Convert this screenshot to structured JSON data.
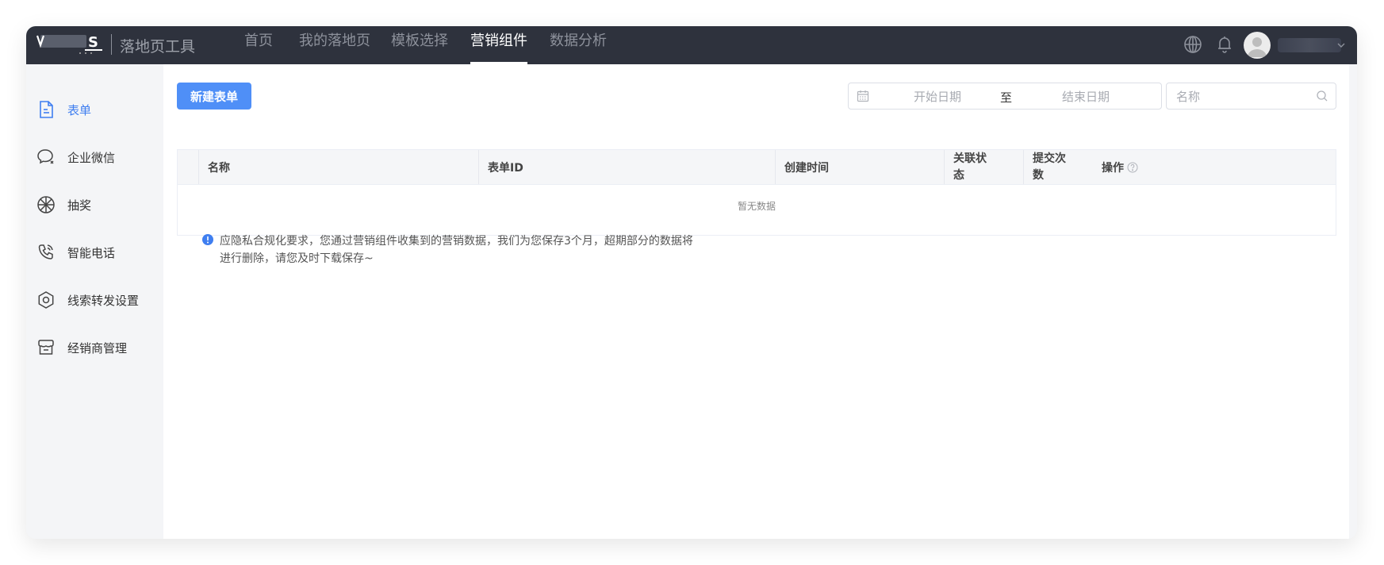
{
  "header": {
    "logo_text": "S",
    "app_title": "落地页工具",
    "tabs": [
      {
        "label": "首页"
      },
      {
        "label": "我的落地页"
      },
      {
        "label": "模板选择"
      },
      {
        "label": "营销组件",
        "active": true
      },
      {
        "label": "数据分析"
      }
    ],
    "icons": [
      "globe-icon",
      "bell-icon",
      "avatar",
      "chevron-down-icon"
    ]
  },
  "sidebar": {
    "items": [
      {
        "label": "表单",
        "icon": "form-icon",
        "active": true
      },
      {
        "label": "企业微信",
        "icon": "wechat-work-icon"
      },
      {
        "label": "抽奖",
        "icon": "lottery-wheel-icon"
      },
      {
        "label": "智能电话",
        "icon": "phone-icon"
      },
      {
        "label": "线索转发设置",
        "icon": "hexagon-settings-icon"
      },
      {
        "label": "经销商管理",
        "icon": "store-icon"
      }
    ]
  },
  "toolbar": {
    "new_form_label": "新建表单",
    "date_start_placeholder": "开始日期",
    "date_separator": "至",
    "date_end_placeholder": "结束日期",
    "search_placeholder": "名称"
  },
  "table": {
    "columns": [
      "名称",
      "表单ID",
      "创建时间",
      "关联状态",
      "提交次数",
      "操作"
    ],
    "empty_text": "暂无数据"
  },
  "notice": {
    "text": "应隐私合规化要求，您通过营销组件收集到的营销数据，我们为您保存3个月，超期部分的数据将进行删除，请您及时下载保存~"
  },
  "colors": {
    "topbar_bg": "#2e323d",
    "primary": "#4f8ff7",
    "active_text": "#3f7ef0"
  }
}
